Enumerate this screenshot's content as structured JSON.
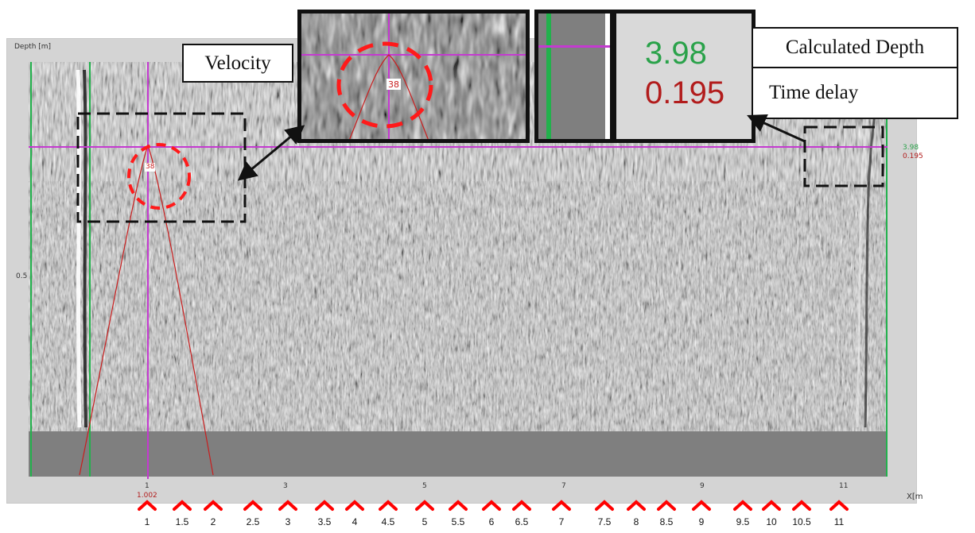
{
  "axis": {
    "depth_title": "Depth [m]",
    "left_tick": "0.5",
    "x_ticks": [
      "1",
      "3",
      "5",
      "7",
      "9",
      "11"
    ],
    "x_label": "X[m"
  },
  "cursor": {
    "x_readout": "1.002",
    "depth_readout": "3.98",
    "time_readout": "0.195",
    "hyperbola_label": "38"
  },
  "zoom_velocity": {
    "label": "38"
  },
  "zoom_readout": {
    "depth": "3.98",
    "time": "0.195"
  },
  "callouts": {
    "velocity": "Velocity",
    "calculated_depth": "Calculated Depth",
    "time_delay": "Time delay"
  },
  "bottom_scale": [
    "1",
    "1.5",
    "2",
    "2.5",
    "3",
    "3.5",
    "4",
    "4.5",
    "5",
    "5.5",
    "6",
    "6.5",
    "7",
    "7.5",
    "8",
    "8.5",
    "9",
    "9.5",
    "10",
    "10.5",
    "11"
  ],
  "colors": {
    "cursor_line": "#c43ad0",
    "green_line": "#22b14c",
    "hyperbola": "#c81e1e",
    "marker": "#ff0000",
    "depth_green": "#2aa24a",
    "time_red": "#b21c1c"
  },
  "icons": [
    "chevron-up-marker",
    "arrow-line"
  ]
}
